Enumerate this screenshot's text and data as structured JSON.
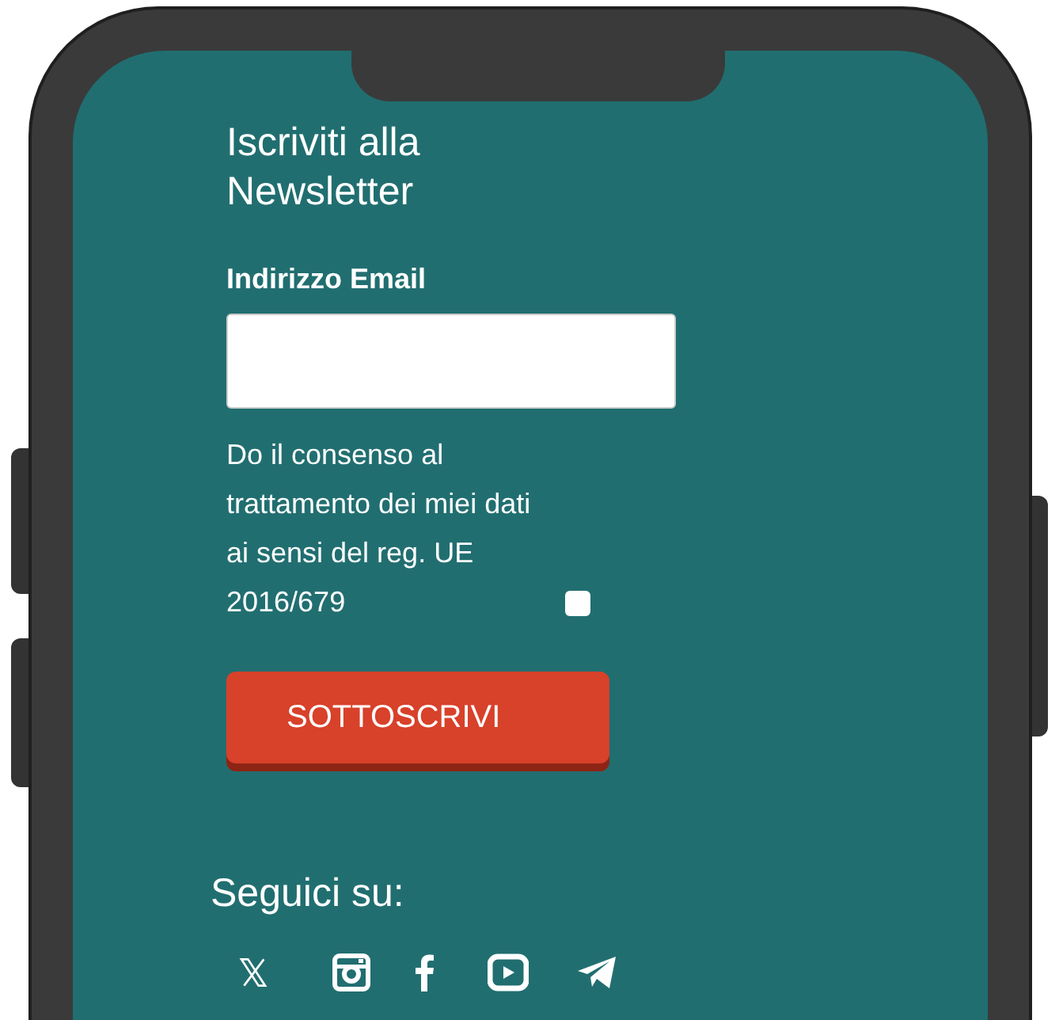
{
  "newsletter": {
    "title": "Iscriviti alla Newsletter",
    "email_label": "Indirizzo Email",
    "consent": {
      "text": "Do il consenso al trattamento dei miei dati ai sensi del reg. UE 2016/679",
      "checked": false
    },
    "button": "SOTTOSCRIVI"
  },
  "social": {
    "title": "Seguici su:",
    "icons": [
      {
        "kind": "x"
      },
      {
        "kind": "instagram"
      },
      {
        "kind": "facebook"
      },
      {
        "kind": "youtube"
      },
      {
        "kind": "telegram"
      }
    ]
  }
}
